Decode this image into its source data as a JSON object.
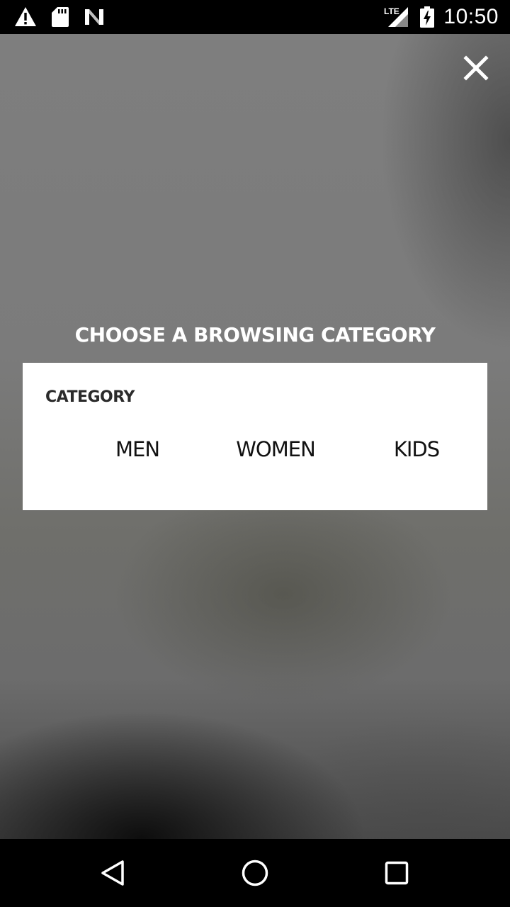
{
  "status_bar": {
    "time": "10:50",
    "network": "LTE",
    "icons": [
      "alert-icon",
      "sd-card-icon",
      "n-logo-icon",
      "lte-signal-icon",
      "battery-charging-icon"
    ]
  },
  "dialog": {
    "heading": "CHOOSE A BROWSING CATEGORY",
    "category_label": "CATEGORY",
    "options": [
      {
        "label": "MEN"
      },
      {
        "label": "WOMEN"
      },
      {
        "label": "KIDS"
      }
    ],
    "close_icon": "close-icon"
  },
  "nav_bar": {
    "icons": [
      "back-icon",
      "home-icon",
      "recents-icon"
    ]
  },
  "colors": {
    "background": "#7b7b7b",
    "card": "#ffffff",
    "heading_text": "#ffffff",
    "label_text": "#2b2b2b"
  }
}
